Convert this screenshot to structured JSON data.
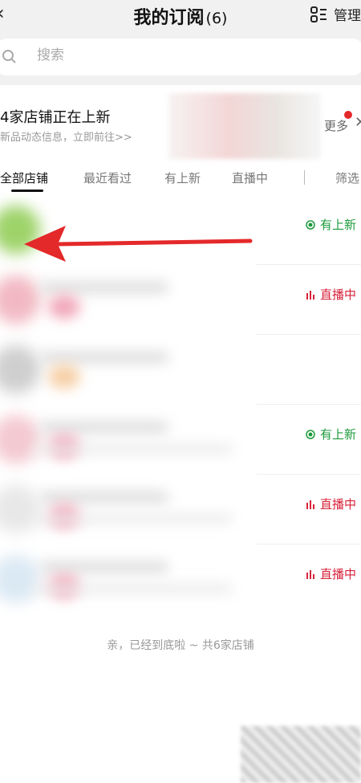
{
  "header": {
    "back_icon": "chevron-left-icon",
    "title": "我的订阅",
    "count": "(6)",
    "manage_icon": "manage-list-icon",
    "manage_label": "管理"
  },
  "search": {
    "placeholder": "搜索",
    "icon": "search-icon"
  },
  "banner": {
    "title": "4家店铺正在上新",
    "subtitle": "新品动态信息，立即前往>>",
    "more_label": "更多",
    "close_icon": "close-icon"
  },
  "tabs": [
    {
      "label": "全部店铺",
      "active": true
    },
    {
      "label": "最近看过",
      "active": false
    },
    {
      "label": "有上新",
      "active": false
    },
    {
      "label": "直播中",
      "active": false
    },
    {
      "label": "筛选",
      "active": false
    }
  ],
  "stores": [
    {
      "status": "有上新",
      "status_type": "new",
      "avatar_color": "#9ed36a"
    },
    {
      "status": "直播中",
      "status_type": "live",
      "avatar_color": "#f2b9c3"
    },
    {
      "status": "",
      "status_type": "none",
      "avatar_color": "#cfcfcf"
    },
    {
      "status": "有上新",
      "status_type": "new",
      "avatar_color": "#f4c9d2"
    },
    {
      "status": "直播中",
      "status_type": "live",
      "avatar_color": "#e8e8e8"
    },
    {
      "status": "直播中",
      "status_type": "live",
      "avatar_color": "#dbe9f4"
    }
  ],
  "footer": {
    "text": "亲，已经到底啦 ~ 共6家店铺"
  },
  "colors": {
    "new": "#1d9a3c",
    "live": "#d7223a",
    "arrow": "#e4292a"
  }
}
